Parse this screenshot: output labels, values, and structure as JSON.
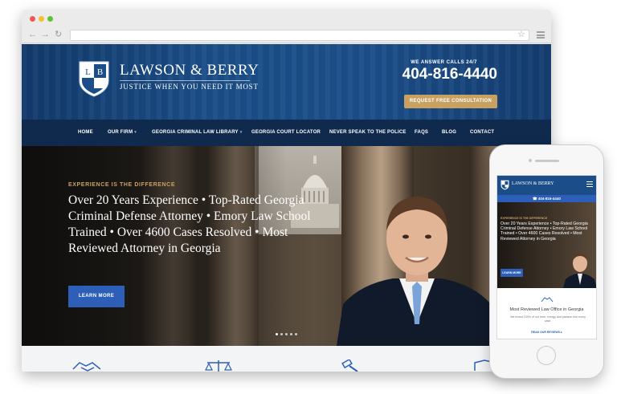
{
  "site": {
    "firm_name": "LAWSON & BERRY",
    "tagline": "JUSTICE WHEN YOU NEED IT MOST",
    "logo_letters": [
      "L",
      "B"
    ],
    "calls_label": "WE ANSWER CALLS 24/7",
    "phone": "404-816-4440",
    "consult_button": "REQUEST FREE CONSULTATION"
  },
  "nav": {
    "items": [
      {
        "label": "HOME"
      },
      {
        "label": "OUR FIRM",
        "caret": "▾"
      },
      {
        "label": "GEORGIA CRIMINAL LAW LIBRARY",
        "caret": "▾"
      },
      {
        "label": "GEORGIA COURT LOCATOR"
      },
      {
        "label": "NEVER SPEAK TO THE POLICE"
      },
      {
        "label": "FAQS"
      },
      {
        "label": "BLOG"
      },
      {
        "label": "CONTACT"
      }
    ]
  },
  "hero": {
    "kicker": "EXPERIENCE IS THE DIFFERENCE",
    "headline": "Over 20 Years Experience • Top-Rated Georgia Criminal Defense Attorney • Emory Law School Trained • Over 4600 Cases Resolved • Most Reviewed Attorney in Georgia",
    "button": "LEARN MORE",
    "slide_count": 5,
    "active_slide": 1
  },
  "features": {
    "icons": [
      "handshake-icon",
      "scales-icon",
      "gavel-icon",
      "book-icon"
    ]
  },
  "mobile": {
    "firm_name": "LAWSON & BERRY",
    "phone": "404-816-4440",
    "kicker": "EXPERIENCE IS THE DIFFERENCE",
    "headline": "Over 20 Years Experience • Top-Rated Georgia Criminal Defense Attorney • Emory Law School Trained • Over 4600 Cases Resolved • Most Reviewed Attorney in Georgia",
    "button": "LEARN MORE",
    "section_title": "Most Reviewed Law Office in Georgia",
    "section_text": "We invest 100% of our time, energy and passion into every case.",
    "reviews_link": "READ OUR REVIEWS ▸"
  },
  "colors": {
    "brand_blue": "#1b4e88",
    "nav_dark": "#0f2a4d",
    "gold": "#c8a161",
    "button_blue": "#2d5fb8"
  }
}
